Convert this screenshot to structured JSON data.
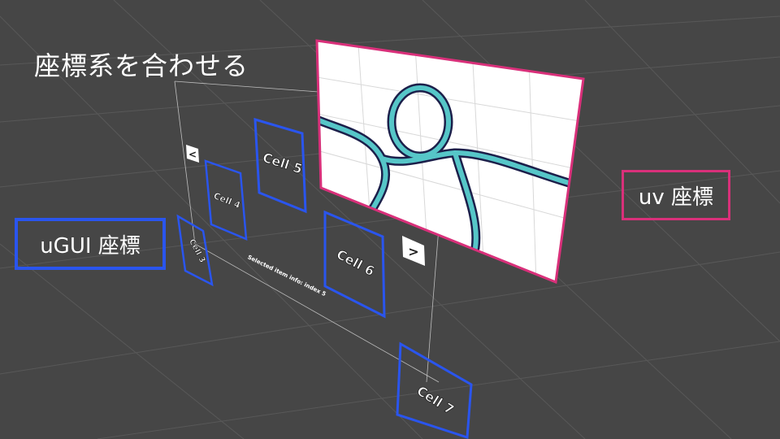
{
  "slide": {
    "title": "座標系を合わせる",
    "ugui_label": "uGUI 座標",
    "uv_label": "uv 座標"
  },
  "scroll_view": {
    "cells": [
      "Cell 3",
      "Cell 4",
      "Cell 5",
      "Cell 6",
      "Cell 7"
    ],
    "prev_button": "<",
    "next_button": ">",
    "status_text": "Selected item info: index 5"
  },
  "colors": {
    "background": "#464646",
    "ugui_frame": "#2a55ee",
    "uv_frame": "#d9307a",
    "shape_fill": "#56c6c8",
    "shape_outline": "#1c1f4a"
  }
}
